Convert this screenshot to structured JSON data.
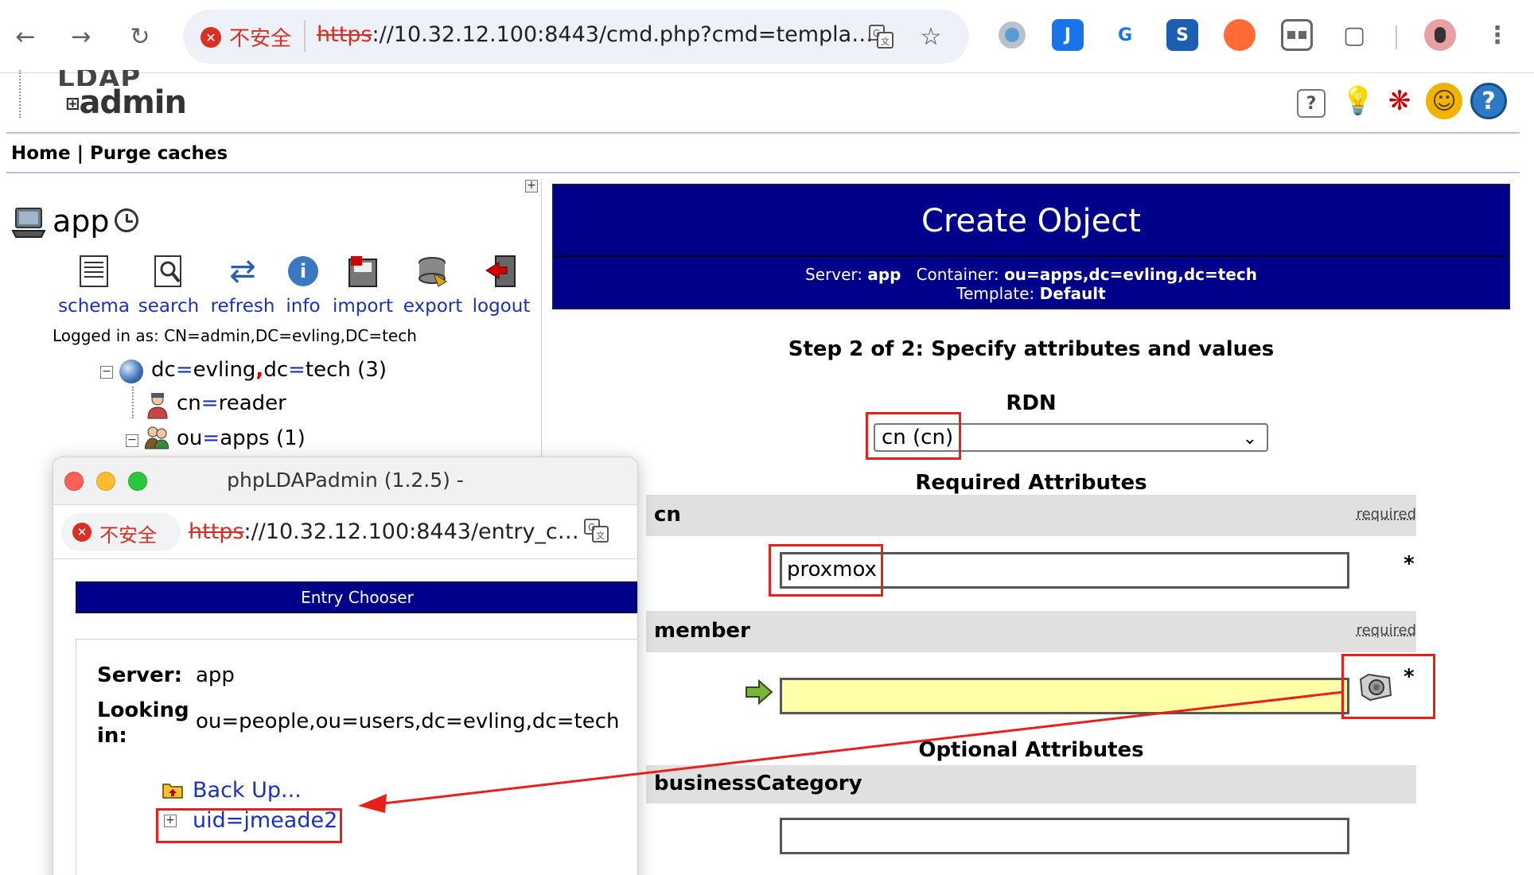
{
  "browser": {
    "insecure_label": "不安全",
    "url_scheme": "https",
    "url_rest": "://10.32.12.100:8443/cmd.php?cmd=templa…",
    "icons": [
      "back-icon",
      "forward-icon",
      "reload-icon",
      "translate-icon",
      "star-icon"
    ],
    "extension_icons": [
      "record-icon",
      "j-extension-icon",
      "google-translate-icon",
      "s-extension-icon",
      "orange-extension-icon",
      "tabs-extension-icon",
      "puzzle-icon",
      "profile-avatar",
      "more-icon"
    ]
  },
  "app": {
    "logo_top": "LDAP",
    "logo_main": "admin",
    "header_icons": [
      "help-icon",
      "bulb-icon",
      "bug-icon",
      "smiley-icon",
      "question-icon"
    ],
    "menu": {
      "home": "Home",
      "sep": " | ",
      "purge": "Purge caches"
    }
  },
  "left": {
    "server": "app",
    "tools": [
      "schema",
      "search",
      "refresh",
      "info",
      "import",
      "export",
      "logout"
    ],
    "logged_in": "Logged in as: CN=admin,DC=evling,DC=tech",
    "tree": {
      "root": {
        "a1": "dc",
        "v1": "evling",
        "a2": "dc",
        "v2": "tech",
        "count": "(3)"
      },
      "child1": {
        "a": "cn",
        "v": "reader"
      },
      "child2": {
        "a": "ou",
        "v": "apps",
        "count": "(1)"
      }
    }
  },
  "main": {
    "title": "Create Object",
    "server_label": "Server:",
    "server_value": "app",
    "container_label": "Container:",
    "container_value": "ou=apps,dc=evling,dc=tech",
    "template_label": "Template:",
    "template_value": "Default",
    "step": "Step 2 of 2: Specify attributes and values",
    "rdn_label": "RDN",
    "rdn_value": "cn (cn)",
    "required_title": "Required Attributes",
    "optional_title": "Optional Attributes",
    "required_tag": "required",
    "attr_cn": "cn",
    "attr_cn_value": "proxmox",
    "attr_member": "member",
    "attr_member_value": "",
    "attr_business": "businessCategory",
    "attr_business_value": "",
    "star": "*"
  },
  "popup": {
    "title": "phpLDAPadmin (1.2.5) -",
    "insecure_label": "不安全",
    "url_scheme": "https",
    "url_rest": "://10.32.12.100:8443/entry_c…",
    "header": "Entry Chooser",
    "server_label": "Server:",
    "server_value": "app",
    "looking_label_1": "Looking",
    "looking_label_2": "in:",
    "looking_value": "ou=people,ou=users,dc=evling,dc=tech",
    "back_up": "Back Up...",
    "entry": "uid=jmeade2"
  },
  "colors": {
    "annotation": "#e8201c",
    "header_blue": "#00008b",
    "link": "#1a32b9"
  }
}
